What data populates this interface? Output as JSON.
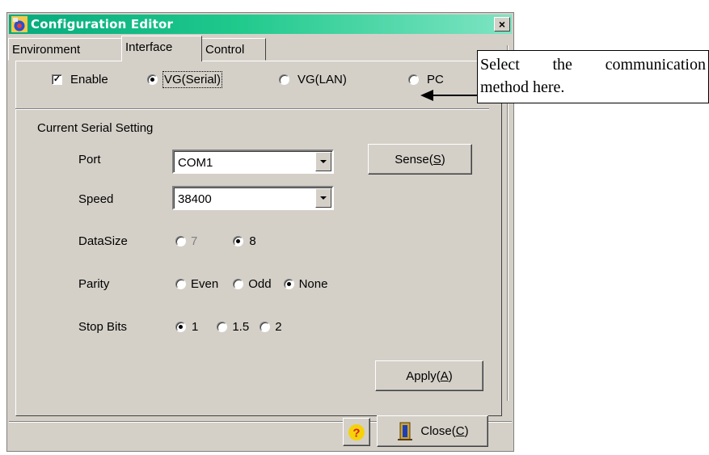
{
  "window": {
    "title": "Configuration Editor",
    "close_glyph": "×",
    "icon": "app-icon"
  },
  "tabs": [
    {
      "label": "Environment",
      "selected": false
    },
    {
      "label": "Interface",
      "selected": true
    },
    {
      "label": "Control",
      "selected": false
    }
  ],
  "comm": {
    "enable_label": "Enable",
    "enable_checked": true,
    "options": [
      {
        "label": "VG(Serial)",
        "selected": true
      },
      {
        "label": "VG(LAN)",
        "selected": false
      },
      {
        "label": "PC",
        "selected": false
      }
    ]
  },
  "serial": {
    "group_label": "Current Serial Setting",
    "port_label": "Port",
    "port_value": "COM1",
    "sense_label": "Sense(",
    "sense_key": "S",
    "sense_close": ")",
    "speed_label": "Speed",
    "speed_value": "38400",
    "datasize_label": "DataSize",
    "datasize_options": [
      {
        "label": "7",
        "selected": false,
        "disabled": true
      },
      {
        "label": "8",
        "selected": true,
        "disabled": false
      }
    ],
    "parity_label": "Parity",
    "parity_options": [
      {
        "label": "Even",
        "selected": false
      },
      {
        "label": "Odd",
        "selected": false
      },
      {
        "label": "None",
        "selected": true
      }
    ],
    "stopbits_label": "Stop Bits",
    "stopbits_options": [
      {
        "label": "1",
        "selected": true
      },
      {
        "label": "1.5",
        "selected": false
      },
      {
        "label": "2",
        "selected": false
      }
    ],
    "apply_label": "Apply(",
    "apply_key": "A",
    "apply_close": ")"
  },
  "footer": {
    "help_icon": "help-icon",
    "close_label": "Close(",
    "close_key": "C",
    "close_close": ")"
  },
  "callout": {
    "line1_words": [
      "Select",
      "the",
      "communication"
    ],
    "line2": "method here."
  },
  "colors": {
    "titlebar_start": "#06aa7e",
    "titlebar_end": "#7ee4c3",
    "face": "#d4d0c8"
  }
}
